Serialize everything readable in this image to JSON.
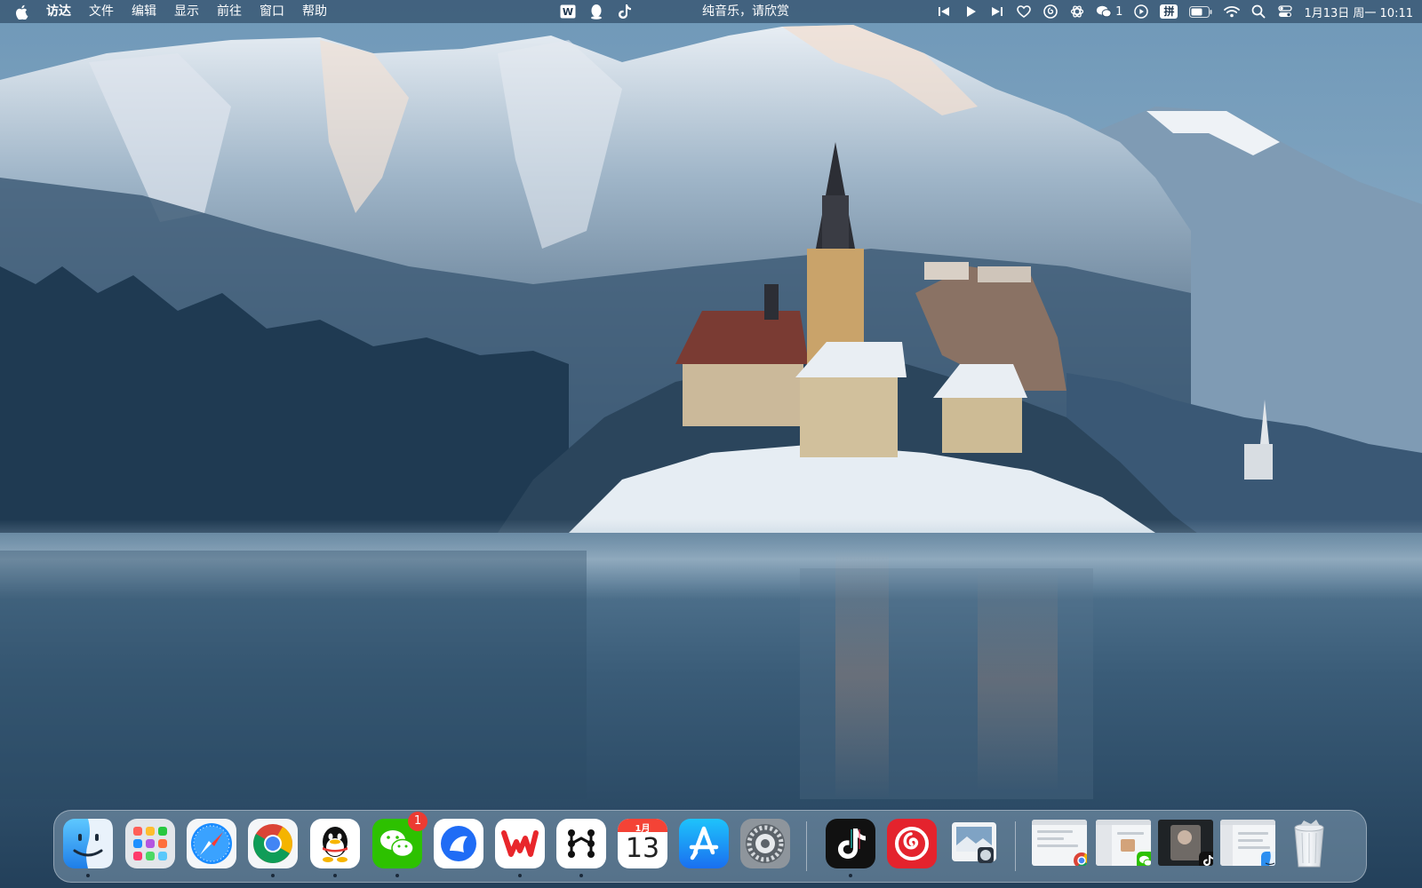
{
  "menubar": {
    "app_name": "访达",
    "menus": [
      "文件",
      "编辑",
      "显示",
      "前往",
      "窗口",
      "帮助"
    ],
    "now_playing": "纯音乐，请欣赏",
    "wechat_unread": "1",
    "input_method": "拼",
    "clock": "1月13日 周一  10:11",
    "status_icons": [
      "wps-icon",
      "qq-icon",
      "tiktok-icon",
      "previous-track-icon",
      "play-icon",
      "next-track-icon",
      "heart-icon",
      "netease-music-icon",
      "chatgpt-icon",
      "wechat-icon",
      "screen-record-icon",
      "battery-icon",
      "wifi-icon",
      "search-icon",
      "control-center-icon"
    ]
  },
  "dock": {
    "apps": [
      {
        "name": "访达",
        "icon": "finder-icon",
        "running": true
      },
      {
        "name": "启动台",
        "icon": "launchpad-icon",
        "running": false
      },
      {
        "name": "Safari浏览器",
        "icon": "safari-icon",
        "running": false
      },
      {
        "name": "Google Chrome",
        "icon": "chrome-icon",
        "running": true
      },
      {
        "name": "QQ",
        "icon": "qq-icon",
        "running": true
      },
      {
        "name": "微信",
        "icon": "wechat-icon",
        "running": true,
        "badge": "1"
      },
      {
        "name": "Lark",
        "icon": "lark-icon",
        "running": false
      },
      {
        "name": "WPS Office",
        "icon": "wps-icon",
        "running": true
      },
      {
        "name": "OmniFocus",
        "icon": "dots-icon",
        "running": true
      },
      {
        "name": "日历",
        "icon": "calendar-icon",
        "running": false
      },
      {
        "name": "App Store",
        "icon": "app-store-icon",
        "running": false
      },
      {
        "name": "系统设置",
        "icon": "settings-icon",
        "running": false
      },
      {
        "name": "抖音",
        "icon": "tiktok-icon",
        "running": true
      },
      {
        "name": "网易云音乐",
        "icon": "netease-music-icon",
        "running": false
      },
      {
        "name": "预览",
        "icon": "preview-icon",
        "running": false
      }
    ],
    "calendar": {
      "month": "1月",
      "day": "13"
    },
    "minimized_windows": [
      "chrome-window",
      "wechat-window",
      "tiktok-window",
      "finder-window"
    ],
    "trash": "trash-icon"
  },
  "colors": {
    "menubar_bg": "#1e3750",
    "badge": "#ec3b32",
    "sky": "#5f8bab",
    "lake": "#2e4e6b"
  }
}
